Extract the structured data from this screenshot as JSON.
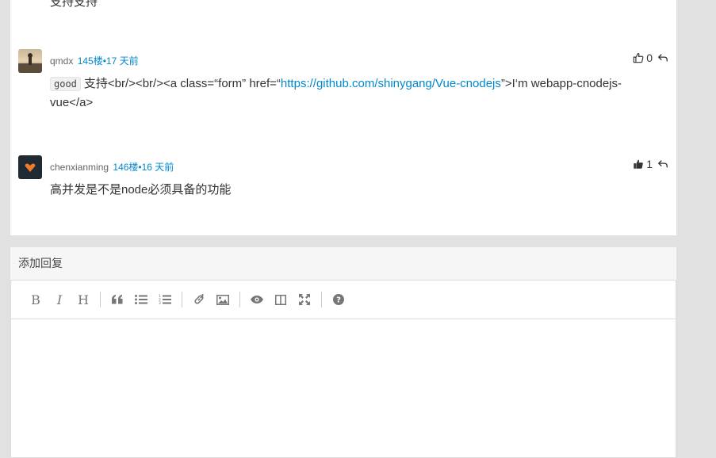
{
  "previous_reply_tail": "支持支持",
  "replies": [
    {
      "author": "qmdx",
      "floor": "145楼•17 天前",
      "likes": "0",
      "content": {
        "code": "good",
        "before_link": "支持<br/><br/><a class=“form” href=“",
        "link": "https://github.com/shinygang/Vue-cnodejs",
        "after_link": "”>I‘m webapp-cnodejs-vue</a>"
      }
    },
    {
      "author": "chenxianming",
      "floor": "146楼•16 天前",
      "likes": "1",
      "content": {
        "text": "高并发是不是node必须具备的功能"
      }
    }
  ],
  "reply_box": {
    "title": "添加回复",
    "toolbar": [
      "bold-icon",
      "italic-icon",
      "heading-icon",
      "quote-icon",
      "unordered-list-icon",
      "ordered-list-icon",
      "link-icon",
      "image-icon",
      "preview-icon",
      "side-by-side-icon",
      "fullscreen-icon",
      "help-icon"
    ],
    "bold": "B",
    "italic": "I",
    "heading": "H"
  }
}
